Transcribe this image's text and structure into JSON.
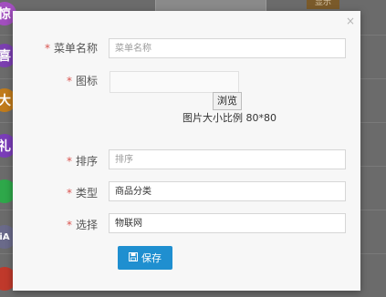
{
  "background": {
    "icons": [
      {
        "name": "jing-badge",
        "char": "惊",
        "color": "#a24fbf"
      },
      {
        "name": "xi-badge",
        "char": "喜",
        "color": "#7b3fb0"
      },
      {
        "name": "da-badge",
        "char": "大",
        "color": "#c07b1b"
      },
      {
        "name": "li-badge",
        "char": "礼",
        "color": "#7a3db8"
      },
      {
        "name": "chat-badge",
        "char": "",
        "color": "#2ea84a"
      },
      {
        "name": "ai-badge",
        "char": "iA",
        "color": "#6a6a8a"
      },
      {
        "name": "drop-badge",
        "char": "",
        "color": "#c0392b"
      }
    ],
    "top_button": "显示"
  },
  "modal": {
    "close": "×",
    "fields": [
      {
        "key": "menu_name",
        "label": "菜单名称",
        "required": "*",
        "placeholder": "菜单名称",
        "value": ""
      },
      {
        "key": "icon",
        "label": "图标",
        "required": "*"
      },
      {
        "key": "sort",
        "label": "排序",
        "required": "*",
        "placeholder": "排序",
        "value": ""
      },
      {
        "key": "type",
        "label": "类型",
        "required": "*",
        "value": "商品分类"
      },
      {
        "key": "select",
        "label": "选择",
        "required": "*",
        "value": "物联网"
      }
    ],
    "browse_label": "浏览",
    "image_hint": "图片大小比例 80*80",
    "save_label": "保存"
  }
}
